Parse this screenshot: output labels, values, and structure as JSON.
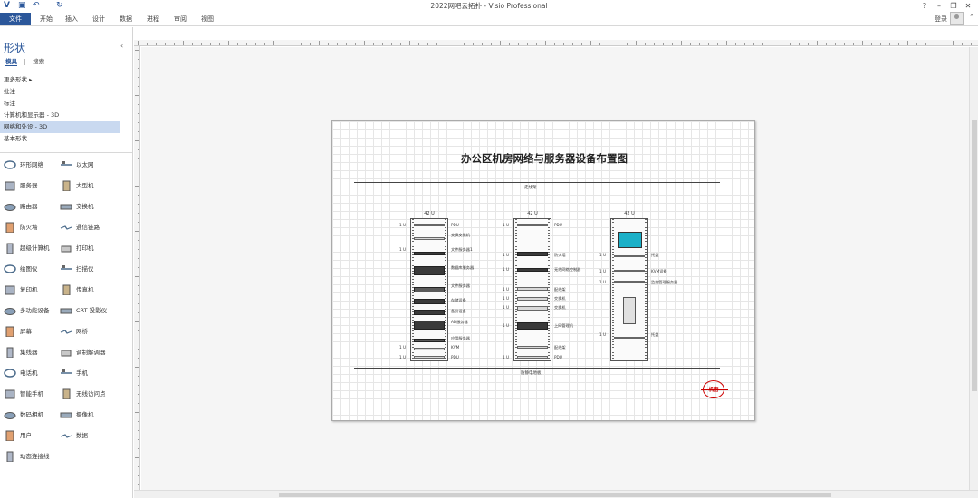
{
  "window": {
    "title": "2022网吧云拓扑 - Visio Professional",
    "help": "?",
    "min": "–",
    "restore": "❐",
    "close": "✕"
  },
  "quick_access": {
    "undo": "↶",
    "redo": "↻",
    "save": "▣"
  },
  "ribbon": {
    "tabs": [
      "文件",
      "开始",
      "插入",
      "设计",
      "数据",
      "进程",
      "审阅",
      "视图"
    ],
    "login": "登录"
  },
  "shapes_pane": {
    "title": "形状",
    "tabs": [
      "模具",
      "搜索"
    ],
    "stencils": [
      "更多形状",
      "批注",
      "标注",
      "计算机和显示器 - 3D",
      "网络和外设 - 3D",
      "基本形状"
    ],
    "active_stencil_index": 4,
    "shapes": [
      {
        "label": "环形网络",
        "icon": "ring-network-icon"
      },
      {
        "label": "以太网",
        "icon": "ethernet-icon"
      },
      {
        "label": "服务器",
        "icon": "server-icon"
      },
      {
        "label": "大型机",
        "icon": "mainframe-icon"
      },
      {
        "label": "路由器",
        "icon": "router-icon"
      },
      {
        "label": "交换机",
        "icon": "switch-icon"
      },
      {
        "label": "防火墙",
        "icon": "firewall-icon"
      },
      {
        "label": "通信链路",
        "icon": "comm-link-icon"
      },
      {
        "label": "超级计算机",
        "icon": "supercomputer-icon"
      },
      {
        "label": "打印机",
        "icon": "printer-icon"
      },
      {
        "label": "绘图仪",
        "icon": "plotter-icon"
      },
      {
        "label": "扫描仪",
        "icon": "scanner-icon"
      },
      {
        "label": "复印机",
        "icon": "copier-icon"
      },
      {
        "label": "传真机",
        "icon": "fax-icon"
      },
      {
        "label": "多功能设备",
        "icon": "multifunction-icon"
      },
      {
        "label": "CRT 投影仪",
        "icon": "projector-icon"
      },
      {
        "label": "屏幕",
        "icon": "screen-icon"
      },
      {
        "label": "网桥",
        "icon": "bridge-icon"
      },
      {
        "label": "集线器",
        "icon": "hub-icon"
      },
      {
        "label": "调制解调器",
        "icon": "modem-icon"
      },
      {
        "label": "电话机",
        "icon": "telephone-icon"
      },
      {
        "label": "手机",
        "icon": "mobile-phone-icon"
      },
      {
        "label": "智能手机",
        "icon": "smartphone-icon"
      },
      {
        "label": "无线访问点",
        "icon": "wireless-ap-icon"
      },
      {
        "label": "数码相机",
        "icon": "digital-camera-icon"
      },
      {
        "label": "摄像机",
        "icon": "video-camera-icon"
      },
      {
        "label": "用户",
        "icon": "user-icon"
      },
      {
        "label": "数据",
        "icon": "data-icon"
      },
      {
        "label": "动态连接线",
        "icon": "dynamic-connector-icon"
      }
    ]
  },
  "diagram": {
    "title": "办公区机房网络与服务器设备布置图",
    "top_label": "走线架",
    "bottom_label": "防静电地板",
    "stamp": "机密",
    "racks": [
      {
        "head": "42 U",
        "labels": [
          "PDU",
          "交换交换机",
          "文件服务器1",
          "数据库服务器",
          "文件服务器",
          "存储设备",
          "备份设备",
          "AD服务器",
          "应用服务器",
          "KVM",
          "PDU"
        ],
        "numbers": [
          "1 U",
          "1 U",
          "1 U",
          "1 U"
        ]
      },
      {
        "head": "42 U",
        "labels": [
          "PDU",
          "防火墙",
          "无线网络控制器",
          "配线架",
          "交换机",
          "交换机",
          "上网管理机",
          "配线架",
          "PDU"
        ],
        "numbers": [
          "1 U",
          "1 U",
          "1 U",
          "1 U",
          "1 U",
          "1 U",
          "1 U",
          "1 U"
        ]
      },
      {
        "head": "42 U",
        "labels": [
          "托盘",
          "KVM设备",
          "监控管理服务器",
          "托盘"
        ],
        "numbers": [
          "1 U",
          "1 U",
          "1 U",
          "1 U"
        ]
      }
    ]
  }
}
